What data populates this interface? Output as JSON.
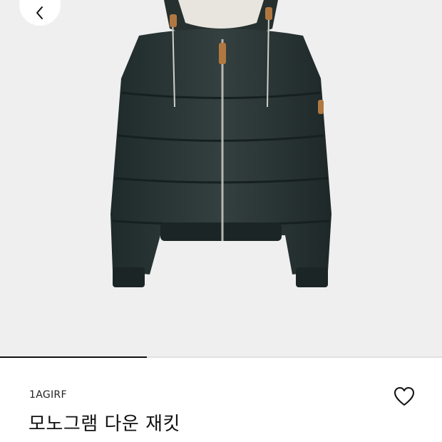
{
  "nav": {
    "back_icon": "chevron-left-icon"
  },
  "gallery": {
    "progress": 0.333,
    "image_alt": "product-jacket-photo"
  },
  "product": {
    "sku": "1AGIRF",
    "name": "모노그램 다운 재킷",
    "wishlist_icon": "heart-outline-icon"
  },
  "colors": {
    "jacket": "#2a3536",
    "background": "#efefef",
    "accent": "#111111"
  }
}
